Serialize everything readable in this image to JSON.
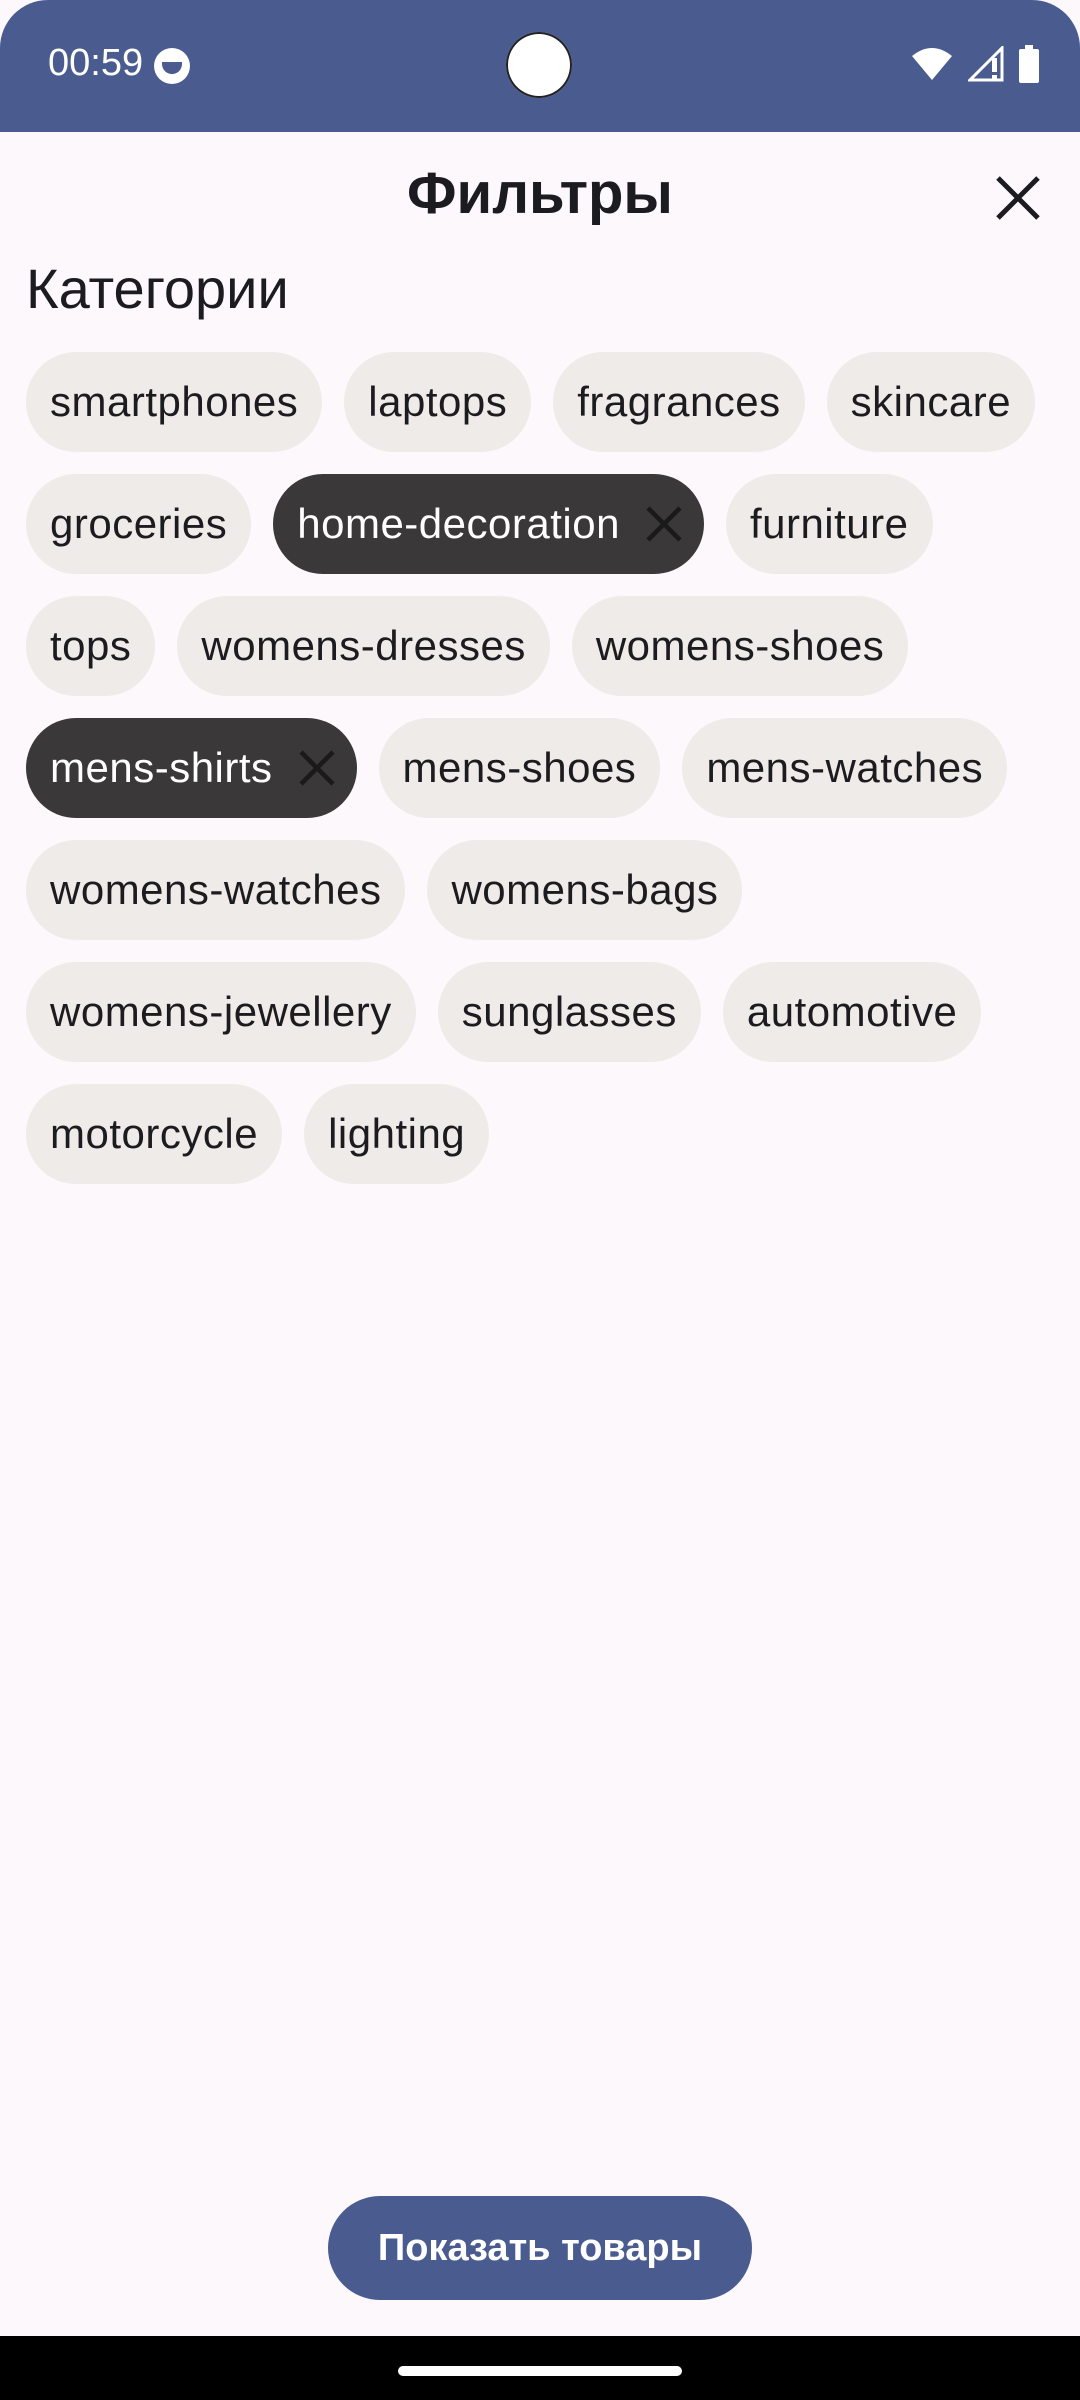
{
  "status_bar": {
    "time": "00:59",
    "icons": [
      "face-icon",
      "wifi-icon",
      "signal-icon",
      "battery-icon"
    ],
    "color": "#4a5b90"
  },
  "header": {
    "title": "Фильтры",
    "close_icon": "close-icon"
  },
  "categories": {
    "title": "Категории",
    "chips": [
      {
        "label": "smartphones",
        "selected": false
      },
      {
        "label": "laptops",
        "selected": false
      },
      {
        "label": "fragrances",
        "selected": false
      },
      {
        "label": "skincare",
        "selected": false
      },
      {
        "label": "groceries",
        "selected": false
      },
      {
        "label": "home-decoration",
        "selected": true
      },
      {
        "label": "furniture",
        "selected": false
      },
      {
        "label": "tops",
        "selected": false
      },
      {
        "label": "womens-dresses",
        "selected": false
      },
      {
        "label": "womens-shoes",
        "selected": false
      },
      {
        "label": "mens-shirts",
        "selected": true
      },
      {
        "label": "mens-shoes",
        "selected": false
      },
      {
        "label": "mens-watches",
        "selected": false
      },
      {
        "label": "womens-watches",
        "selected": false
      },
      {
        "label": "womens-bags",
        "selected": false
      },
      {
        "label": "womens-jewellery",
        "selected": false
      },
      {
        "label": "sunglasses",
        "selected": false
      },
      {
        "label": "automotive",
        "selected": false
      },
      {
        "label": "motorcycle",
        "selected": false
      },
      {
        "label": "lighting",
        "selected": false
      }
    ]
  },
  "footer": {
    "show_button_label": "Показать товары",
    "accent": "#4a5b90"
  }
}
